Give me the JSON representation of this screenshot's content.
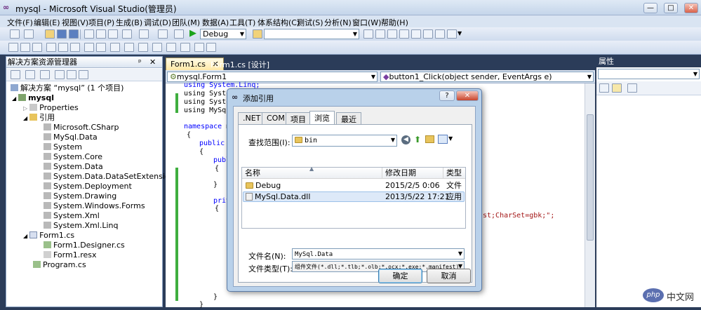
{
  "window": {
    "title": "mysql - Microsoft Visual Studio(管理员)",
    "min": "—",
    "max": "□",
    "close": "✕"
  },
  "menu": [
    "文件(F)",
    "编辑(E)",
    "视图(V)",
    "项目(P)",
    "生成(B)",
    "调试(D)",
    "团队(M)",
    "数据(A)",
    "工具(T)",
    "体系结构(C)",
    "测试(S)",
    "分析(N)",
    "窗口(W)",
    "帮助(H)"
  ],
  "toolbar": {
    "config": "Debug",
    "search_value": ""
  },
  "solution_explorer": {
    "title": "解决方案资源管理器",
    "pin": "ᵖ",
    "close": "✕",
    "items": [
      {
        "text": "解决方案 “mysql” (1 个项目)",
        "level": 0,
        "icon": "solution-icon",
        "bold": false
      },
      {
        "text": "mysql",
        "level": 1,
        "icon": "csharp-project-icon",
        "bold": true
      },
      {
        "text": "Properties",
        "level": 2,
        "icon": "properties-icon",
        "bold": false
      },
      {
        "text": "引用",
        "level": 2,
        "icon": "references-folder-icon",
        "bold": false
      },
      {
        "text": "Microsoft.CSharp",
        "level": 3,
        "icon": "reference-icon",
        "bold": false
      },
      {
        "text": "MySql.Data",
        "level": 3,
        "icon": "reference-icon",
        "bold": false
      },
      {
        "text": "System",
        "level": 3,
        "icon": "reference-icon",
        "bold": false
      },
      {
        "text": "System.Core",
        "level": 3,
        "icon": "reference-icon",
        "bold": false
      },
      {
        "text": "System.Data",
        "level": 3,
        "icon": "reference-icon",
        "bold": false
      },
      {
        "text": "System.Data.DataSetExtensions",
        "level": 3,
        "icon": "reference-icon",
        "bold": false
      },
      {
        "text": "System.Deployment",
        "level": 3,
        "icon": "reference-icon",
        "bold": false
      },
      {
        "text": "System.Drawing",
        "level": 3,
        "icon": "reference-icon",
        "bold": false
      },
      {
        "text": "System.Windows.Forms",
        "level": 3,
        "icon": "reference-icon",
        "bold": false
      },
      {
        "text": "System.Xml",
        "level": 3,
        "icon": "reference-icon",
        "bold": false
      },
      {
        "text": "System.Xml.Linq",
        "level": 3,
        "icon": "reference-icon",
        "bold": false
      },
      {
        "text": "Form1.cs",
        "level": 2,
        "icon": "form-icon",
        "bold": false
      },
      {
        "text": "Form1.Designer.cs",
        "level": 3,
        "icon": "cs-file-icon",
        "bold": false
      },
      {
        "text": "Form1.resx",
        "level": 3,
        "icon": "resx-file-icon",
        "bold": false
      },
      {
        "text": "Program.cs",
        "level": 2,
        "icon": "cs-file-icon",
        "bold": false
      }
    ]
  },
  "tabs": [
    {
      "label": "Form1.cs",
      "close": "✕"
    },
    {
      "label": "Form1.cs [设计]"
    }
  ],
  "navbar": {
    "class": "mysql.Form1",
    "member": "button1_Click(object sender, EventArgs e)"
  },
  "code": {
    "using1": "using System.Linq;",
    "using2": "using System",
    "using3": "using System",
    "using4": "using MySql.",
    "ns_kw": "namespace",
    "ns_name": " mys",
    "brace_open": "{",
    "public1": "public",
    "p": " p",
    "brace2": "{",
    "publ": "publ",
    "brace3": "{",
    "brace3c": "}",
    "priv": "priv",
    "brace4": "{",
    "conn_tail": "st;CharSet=gbk;\";",
    "brace4c": "}",
    "brace_close": "}"
  },
  "properties": {
    "title": "属性",
    "close": "✕"
  },
  "dialog": {
    "title": "添加引用",
    "help": "?",
    "close": "✕",
    "tabs": [
      ".NET",
      "COM",
      "项目",
      "浏览",
      "最近"
    ],
    "selected_tab": "浏览",
    "lookin_label": "查找范围(I):",
    "lookin_value": "bin",
    "columns": {
      "name": "名称",
      "date": "修改日期",
      "type": "类型"
    },
    "files": [
      {
        "name": "Debug",
        "date": "2015/2/5 0:06",
        "type": "文件",
        "kind": "folder"
      },
      {
        "name": "MySql.Data.dll",
        "date": "2013/5/22 17:21",
        "type": "应用",
        "kind": "dll"
      }
    ],
    "filename_label": "文件名(N):",
    "filename_value": "MySql.Data",
    "filetype_label": "文件类型(T):",
    "filetype_value": "组件文件(*.dll;*.tlb;*.olb;*.ocx;*.exe;*.manifest)",
    "ok": "确定",
    "cancel": "取消"
  },
  "watermark": {
    "text": "中文网",
    "logo": "php"
  }
}
